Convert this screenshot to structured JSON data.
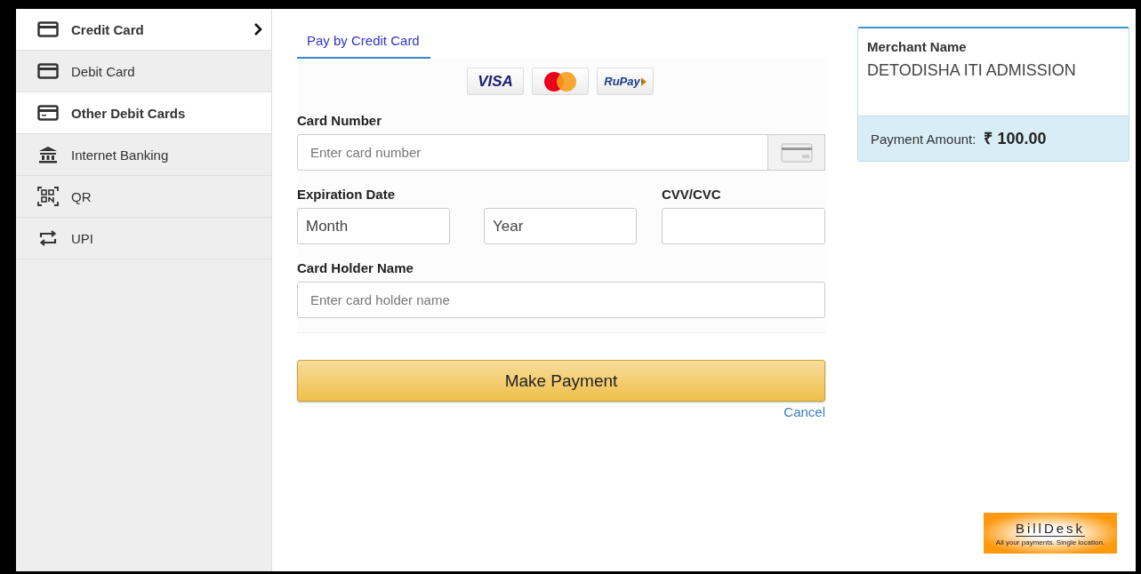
{
  "sidebar": {
    "items": [
      {
        "label": "Credit Card",
        "kind": "card",
        "selected": true,
        "highlighted": true
      },
      {
        "label": "Debit Card",
        "kind": "card",
        "selected": false,
        "highlighted": false
      },
      {
        "label": "Other Debit Cards",
        "kind": "card-dash",
        "selected": false,
        "highlighted": true
      },
      {
        "label": "Internet Banking",
        "kind": "bank",
        "selected": false,
        "highlighted": false
      },
      {
        "label": "QR",
        "kind": "qr",
        "selected": false,
        "highlighted": false
      },
      {
        "label": "UPI",
        "kind": "swap",
        "selected": false,
        "highlighted": false
      }
    ]
  },
  "tabs": [
    {
      "label": "Pay by Credit Card",
      "selected": true
    }
  ],
  "card_logos": [
    {
      "kind": "visa",
      "text": "VISA"
    },
    {
      "kind": "mastercard"
    },
    {
      "kind": "rupay",
      "text": "RuPay"
    }
  ],
  "form": {
    "card_number": {
      "label": "Card Number",
      "placeholder": "Enter card number"
    },
    "expiration": {
      "label": "Expiration Date",
      "month": "Month",
      "year": "Year"
    },
    "cvv": {
      "label": "CVV/CVC"
    },
    "holder": {
      "label": "Card Holder Name",
      "placeholder": "Enter card holder name"
    }
  },
  "pay_button": "Make Payment",
  "cancel_link": "Cancel",
  "merchant": {
    "label": "Merchant Name",
    "name": "DETODISHA ITI ADMISSION",
    "amount_label": "Payment Amount:",
    "amount": "₹ 100.00"
  },
  "brand": {
    "name": "BillDesk",
    "tagline": "All your payments. Single location."
  }
}
